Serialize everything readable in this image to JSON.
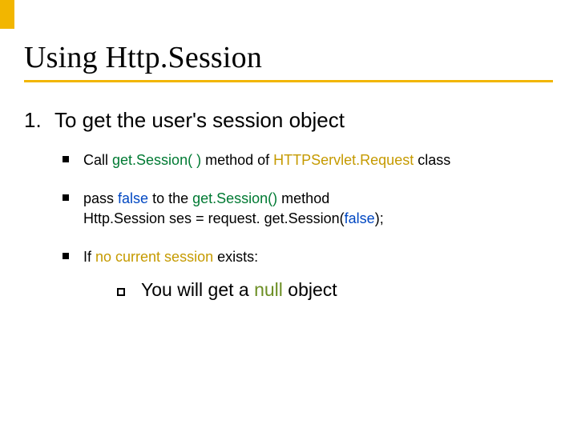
{
  "title": "Using Http.Session",
  "item": {
    "number": "1.",
    "text": "To get the user's session object"
  },
  "bullets": {
    "b1": {
      "t1": "Call ",
      "fn": "get.Session( )",
      "t2": " method of ",
      "cls": "HTTPServlet.Request",
      "t3": " class"
    },
    "b2": {
      "t1": "pass ",
      "kw1": "false",
      "t2": " to the ",
      "fn1": "get.Session()",
      "t3": " method",
      "line2a": "Http.Session ses = request. get.Session(",
      "kw2": "false",
      "line2b": ");"
    },
    "b3": {
      "t1": "If ",
      "hl": "no current session",
      "t2": " exists:",
      "sub_t1": "You will get a ",
      "sub_kw": "null",
      "sub_t2": " object"
    }
  }
}
